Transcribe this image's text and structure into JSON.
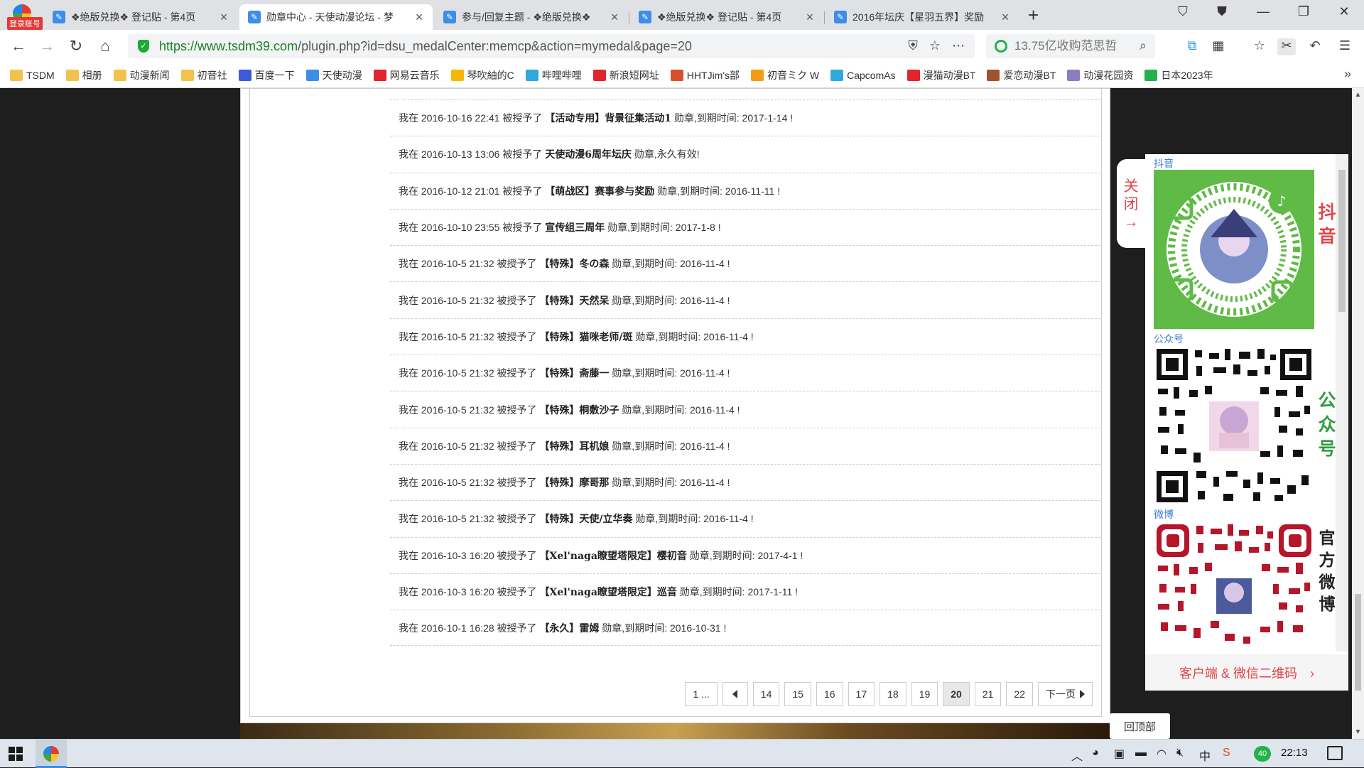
{
  "browser": {
    "badge": "登录账号",
    "tabs": [
      {
        "title": "❖绝版兑换❖ 登记贴 - 第4页",
        "active": false
      },
      {
        "title": "勋章中心 - 天使动漫论坛 - 梦",
        "active": true
      },
      {
        "title": "参与/回复主题 - ❖绝版兑换❖",
        "active": false
      },
      {
        "title": "❖绝版兑换❖ 登记贴 - 第4页",
        "active": false
      },
      {
        "title": "2016年坛庆【星羽五界】奖励",
        "active": false
      }
    ],
    "url_host": "https://www.tsdm39.com",
    "url_rest": "/plugin.php?id=dsu_medalCenter:memcp&action=mymedal&page=20",
    "search_placeholder": "13.75亿收购范思哲",
    "bookmarks": [
      {
        "label": "TSDM",
        "icon": "folder-icon",
        "color": "#f2c14e"
      },
      {
        "label": "相册",
        "icon": "folder-icon",
        "color": "#f2c14e"
      },
      {
        "label": "动漫新闻",
        "icon": "folder-icon",
        "color": "#f2c14e"
      },
      {
        "label": "初音社",
        "icon": "folder-icon",
        "color": "#f2c14e"
      },
      {
        "label": "百度一下",
        "icon": "baidu-icon",
        "color": "#3b5bdb"
      },
      {
        "label": "天使动漫",
        "icon": "tsdm-icon",
        "color": "#3d8de9"
      },
      {
        "label": "网易云音乐",
        "icon": "netease-icon",
        "color": "#e0252b"
      },
      {
        "label": "琴吹紬的C",
        "icon": "star-icon",
        "color": "#f5b700"
      },
      {
        "label": "哔哩哔哩",
        "icon": "bilibili-icon",
        "color": "#2fa8e0"
      },
      {
        "label": "新浪短网址",
        "icon": "weibo-icon",
        "color": "#e0252b"
      },
      {
        "label": "HHTJim's部",
        "icon": "feather-icon",
        "color": "#d94f2b"
      },
      {
        "label": "初音ミク W",
        "icon": "miku-icon",
        "color": "#f39c12"
      },
      {
        "label": "CapcomAs",
        "icon": "bilibili-icon",
        "color": "#2fa8e0"
      },
      {
        "label": "漫猫动漫BT",
        "icon": "cat-icon",
        "color": "#e0252b"
      },
      {
        "label": "爱恋动漫BT",
        "icon": "avatar-icon",
        "color": "#a0522d"
      },
      {
        "label": "动漫花园资",
        "icon": "flower-icon",
        "color": "#8e7cc3"
      },
      {
        "label": "日本2023年",
        "icon": "leaf-icon",
        "color": "#23b14d"
      }
    ]
  },
  "medals": [
    {
      "prefix": "我在 2016-10-16 22:41 被授予了 ",
      "name": "【活动专用】背景征集活动1",
      "suffix": " 勋章,到期时间: 2017-1-14 !"
    },
    {
      "prefix": "我在 2016-10-13 13:06 被授予了 ",
      "name": "天使动漫6周年坛庆",
      "suffix": " 勋章,永久有效!"
    },
    {
      "prefix": "我在 2016-10-12 21:01 被授予了 ",
      "name": "【萌战区】赛事参与奖励",
      "suffix": " 勋章,到期时间: 2016-11-11 !"
    },
    {
      "prefix": "我在 2016-10-10 23:55 被授予了 ",
      "name": "宣传组三周年",
      "suffix": " 勋章,到期时间: 2017-1-8 !"
    },
    {
      "prefix": "我在 2016-10-5 21:32 被授予了 ",
      "name": "【特殊】冬の森",
      "suffix": " 勋章,到期时间: 2016-11-4 !"
    },
    {
      "prefix": "我在 2016-10-5 21:32 被授予了 ",
      "name": "【特殊】天然呆",
      "suffix": " 勋章,到期时间: 2016-11-4 !"
    },
    {
      "prefix": "我在 2016-10-5 21:32 被授予了 ",
      "name": "【特殊】猫咪老师/斑",
      "suffix": " 勋章,到期时间: 2016-11-4 !"
    },
    {
      "prefix": "我在 2016-10-5 21:32 被授予了 ",
      "name": "【特殊】斋藤一",
      "suffix": " 勋章,到期时间: 2016-11-4 !"
    },
    {
      "prefix": "我在 2016-10-5 21:32 被授予了 ",
      "name": "【特殊】桐敷沙子",
      "suffix": " 勋章,到期时间: 2016-11-4 !"
    },
    {
      "prefix": "我在 2016-10-5 21:32 被授予了 ",
      "name": "【特殊】耳机娘",
      "suffix": " 勋章,到期时间: 2016-11-4 !"
    },
    {
      "prefix": "我在 2016-10-5 21:32 被授予了 ",
      "name": "【特殊】摩哥那",
      "suffix": " 勋章,到期时间: 2016-11-4 !"
    },
    {
      "prefix": "我在 2016-10-5 21:32 被授予了 ",
      "name": "【特殊】天使/立华奏",
      "suffix": " 勋章,到期时间: 2016-11-4 !"
    },
    {
      "prefix": "我在 2016-10-3 16:20 被授予了 ",
      "name": "【Xel'naga瞭望塔限定】樱初音",
      "suffix": " 勋章,到期时间: 2017-4-1 !"
    },
    {
      "prefix": "我在 2016-10-3 16:20 被授予了 ",
      "name": "【Xel'naga瞭望塔限定】巡音",
      "suffix": " 勋章,到期时间: 2017-1-11 !"
    },
    {
      "prefix": "我在 2016-10-1 16:28 被授予了 ",
      "name": "【永久】雷姆",
      "suffix": " 勋章,到期时间: 2016-10-31 !"
    }
  ],
  "pagination": {
    "first": "1 ...",
    "pages": [
      "14",
      "15",
      "16",
      "17",
      "18",
      "19",
      "20",
      "21",
      "22"
    ],
    "current": "20",
    "next": "下一页"
  },
  "sidebar": {
    "close_label": "关闭→",
    "douyin_label": "抖音",
    "douyin_side": "抖音",
    "wechat_label": "公众号",
    "wechat_side": "公众号",
    "weibo_label": "微博",
    "weibo_side": "官方微博",
    "footer": "客户端 & 微信二维码　›",
    "back_to_top": "回顶部"
  },
  "taskbar": {
    "clock": "22:13",
    "tray_badge": "40"
  },
  "colors": {
    "accent_red": "#e0454d",
    "douyin_green": "#5fba46",
    "wechat_green": "#2e9e3e",
    "weibo_red": "#b5162a",
    "link_blue": "#3a7bd5"
  }
}
